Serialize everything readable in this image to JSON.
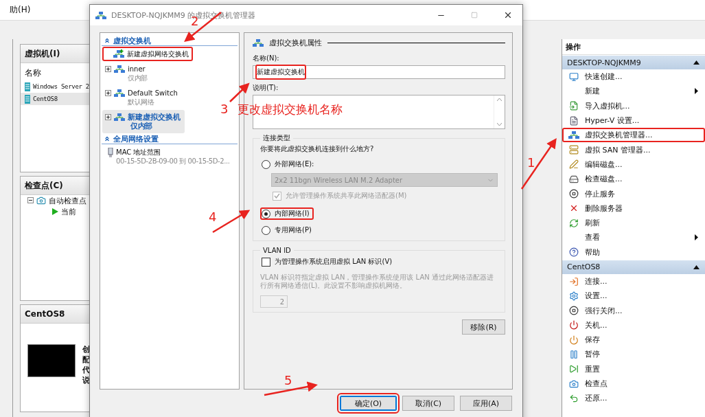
{
  "main_window": {
    "menu_item": "助(H)",
    "vm_panel": {
      "title": "虚拟机(I)",
      "column": "名称",
      "rows": [
        {
          "name": "Windows Server 2",
          "selected": false
        },
        {
          "name": "CentOS8",
          "selected": true
        }
      ]
    },
    "checkpoint_panel": {
      "title": "检查点(C)",
      "tree": [
        {
          "label": "自动检查点",
          "expanded": true,
          "children": [
            {
              "label": "当前"
            }
          ]
        }
      ]
    },
    "details_panel": {
      "title": "CentOS8",
      "lines": [
        "创",
        "配",
        "代",
        "说"
      ]
    },
    "actions": {
      "title": "操作",
      "groups": [
        {
          "title": "DESKTOP-NQJKMM9",
          "expanded": true,
          "items": [
            {
              "label": "快速创建...",
              "submenu": false,
              "highlighted": false
            },
            {
              "label": "新建",
              "submenu": true,
              "highlighted": false
            },
            {
              "label": "导入虚拟机...",
              "submenu": false,
              "highlighted": false
            },
            {
              "label": "Hyper-V 设置...",
              "submenu": false,
              "highlighted": false
            },
            {
              "label": "虚拟交换机管理器...",
              "submenu": false,
              "highlighted": true
            },
            {
              "label": "虚拟 SAN 管理器...",
              "submenu": false,
              "highlighted": false
            },
            {
              "label": "编辑磁盘...",
              "submenu": false,
              "highlighted": false
            },
            {
              "label": "检查磁盘...",
              "submenu": false,
              "highlighted": false
            },
            {
              "label": "停止服务",
              "submenu": false,
              "highlighted": false
            },
            {
              "label": "删除服务器",
              "submenu": false,
              "highlighted": false
            },
            {
              "label": "刷新",
              "submenu": false,
              "highlighted": false
            },
            {
              "label": "查看",
              "submenu": true,
              "highlighted": false
            },
            {
              "label": "帮助",
              "submenu": false,
              "highlighted": false
            }
          ]
        },
        {
          "title": "CentOS8",
          "expanded": true,
          "items": [
            {
              "label": "连接...",
              "submenu": false,
              "highlighted": false
            },
            {
              "label": "设置...",
              "submenu": false,
              "highlighted": false
            },
            {
              "label": "强行关闭...",
              "submenu": false,
              "highlighted": false
            },
            {
              "label": "关机...",
              "submenu": false,
              "highlighted": false
            },
            {
              "label": "保存",
              "submenu": false,
              "highlighted": false
            },
            {
              "label": "暂停",
              "submenu": false,
              "highlighted": false
            },
            {
              "label": "重置",
              "submenu": false,
              "highlighted": false
            },
            {
              "label": "检查点",
              "submenu": false,
              "highlighted": false
            },
            {
              "label": "还原...",
              "submenu": false,
              "highlighted": false
            }
          ]
        }
      ]
    }
  },
  "dialog": {
    "title": "DESKTOP-NQJKMM9 的虚拟交换机管理器",
    "tree": [
      {
        "title": "虚拟交换机",
        "expanded": true,
        "items": [
          {
            "kind": "action",
            "label": "新建虚拟网络交换机",
            "selected": false,
            "highlighted": true
          },
          {
            "kind": "switch",
            "label": "inner",
            "sub": "仅内部",
            "selected": false,
            "highlighted": false
          },
          {
            "kind": "switch",
            "label": "Default Switch",
            "sub": "默认网络",
            "selected": false,
            "highlighted": false
          },
          {
            "kind": "switch",
            "label": "新建虚拟交换机",
            "sub": "仅内部",
            "selected": true,
            "highlighted": false
          }
        ]
      },
      {
        "title": "全局网络设置",
        "expanded": true,
        "items": [
          {
            "kind": "mac",
            "label": "MAC 地址范围",
            "sub": "00-15-5D-2B-09-00 到 00-15-5D-2...",
            "selected": false,
            "highlighted": false
          }
        ]
      }
    ],
    "properties": {
      "title": "虚拟交换机属性",
      "name_label": "名称(N):",
      "name_value": "新建虚拟交换机",
      "name_highlighted": true,
      "notes_label": "说明(T):",
      "connection": {
        "title": "连接类型",
        "question": "你要将此虚拟交换机连接到什么地方?",
        "options": [
          {
            "label": "外部网络(E):",
            "selected": false,
            "highlighted": false
          },
          {
            "label": "内部网络(I)",
            "selected": true,
            "highlighted": true
          },
          {
            "label": "专用网络(P)",
            "selected": false,
            "highlighted": false
          }
        ],
        "adapter": {
          "value": "2x2 11bgn Wireless LAN M.2 Adapter",
          "disabled": true
        },
        "share": {
          "label": "允许管理操作系统共享此网络适配器(M)",
          "checked": true,
          "disabled": true
        }
      },
      "vlan": {
        "title": "VLAN ID",
        "enable": {
          "label": "为管理操作系统启用虚拟 LAN 标识(V)",
          "checked": false
        },
        "help": "VLAN 标识符指定虚拟 LAN，管理操作系统使用该 LAN 通过此网络适配器进行所有网络通信(L)。此设置不影响虚拟机网络。",
        "value": "2",
        "disabled": true
      },
      "remove_button": "移除(R)"
    },
    "buttons": [
      {
        "label": "确定(O)",
        "default": true,
        "highlighted": true
      },
      {
        "label": "取消(C)",
        "default": false,
        "highlighted": false
      },
      {
        "label": "应用(A)",
        "default": false,
        "highlighted": false
      }
    ]
  },
  "annotations": [
    {
      "number": "1"
    },
    {
      "number": "2"
    },
    {
      "number": "3",
      "note": "更改虚拟交换机名称"
    },
    {
      "number": "4"
    },
    {
      "number": "5"
    }
  ]
}
